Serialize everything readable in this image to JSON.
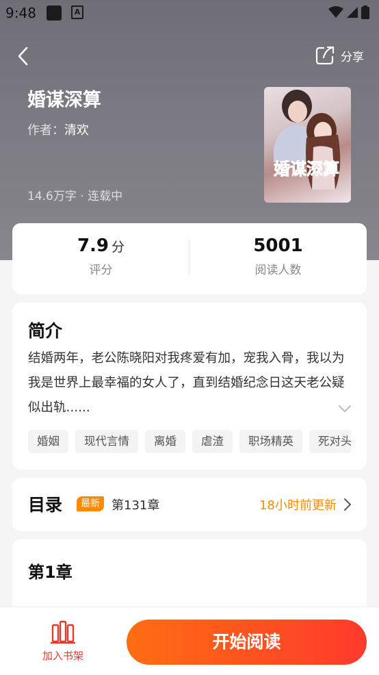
{
  "status_bar": {
    "time": "9:48",
    "notif_letter": "A"
  },
  "header": {
    "share_label": "分享"
  },
  "book": {
    "title": "婚谋深算",
    "author_prefix": "作者：",
    "author": "清欢",
    "meta": "14.6万字 · 连载中",
    "cover_title": "婚谋深算"
  },
  "stats": {
    "rating": "7.9",
    "rating_unit": "分",
    "rating_label": "评分",
    "readers": "5001",
    "readers_label": "阅读人数"
  },
  "intro": {
    "title": "简介",
    "text": "结婚两年，老公陈晓阳对我疼爱有加，宠我入骨，我以为我是世界上最幸福的女人了，直到结婚纪念日这天老公疑似出轨......",
    "tags": [
      "婚姻",
      "现代言情",
      "离婚",
      "虐渣",
      "职场精英",
      "死对头"
    ]
  },
  "toc": {
    "title": "目录",
    "badge": "最新",
    "latest_chapter": "第131章",
    "update_time": "18小时前更新"
  },
  "chapter": {
    "title": "第1章"
  },
  "bottom_bar": {
    "shelf_label": "加入书架",
    "read_label": "开始阅读"
  },
  "colors": {
    "accent": "#ff8a00",
    "primary_red": "#ff3a2c",
    "shelf_red": "#e23b2e"
  }
}
